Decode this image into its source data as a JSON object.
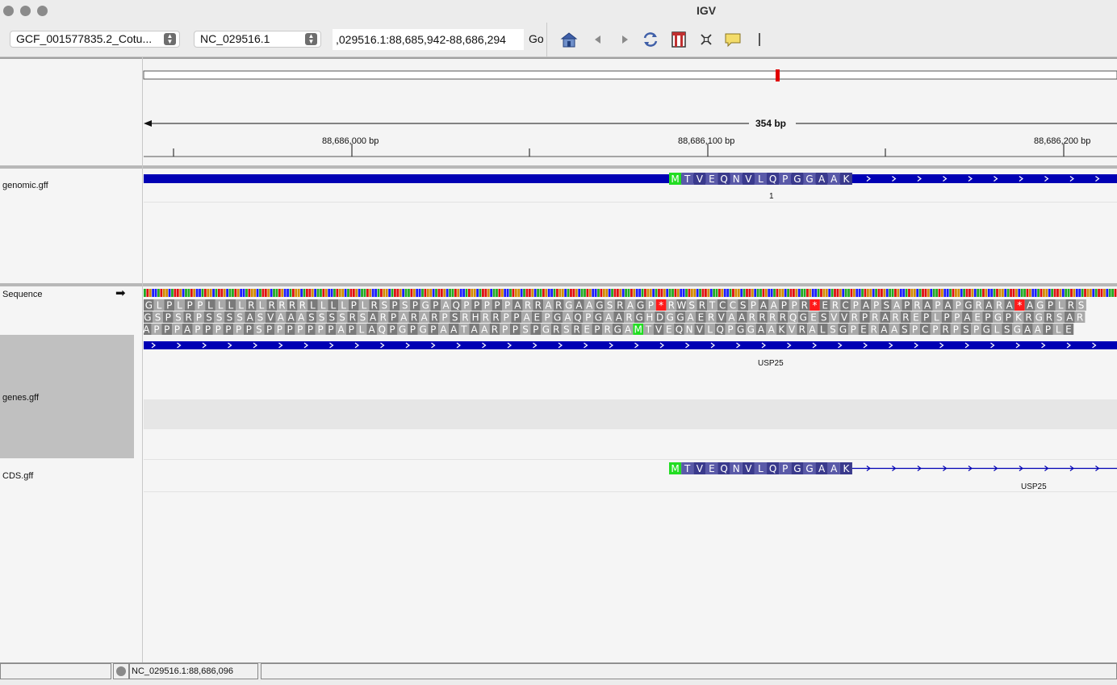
{
  "app_title": "IGV",
  "toolbar": {
    "genome": "GCF_001577835.2_Cotu...",
    "chromosome": "NC_029516.1",
    "locus": ",029516.1:88,685,942-88,686,294",
    "go_label": "Go",
    "icons": [
      "home-icon",
      "back-icon",
      "forward-icon",
      "refresh-icon",
      "roi-icon",
      "fit-window-icon",
      "popup-info-icon",
      "ruler-line-icon"
    ]
  },
  "ruler": {
    "span_label": "354 bp",
    "ticks": [
      "88,686,000 bp",
      "88,686,100 bp",
      "88,686,200 bp"
    ]
  },
  "tracks": {
    "genomic": {
      "name": "genomic.gff",
      "aa": "MTVEQNVLQPGGAAK",
      "feature_label": "1"
    },
    "sequence": {
      "name": "Sequence",
      "strand_arrow": "➡",
      "frames": [
        "GLPLPPLLLLRLRRRRLLLLPLRSPSPGPAQPPPPPARRARGAAGSRAGP*RWSRTCCSPAAPPR*ERCPAPSAPRAPAPGRARA*AGPLRS",
        "GSPSRPSSSSASVAAASSSSRSARPARARPSRHRRPPAEPGAQPGAARGHDGGAERVAARRRRQGESVVRPRARREPLPPAEPGPKRGRSAR",
        "APPPAPPPPPPSPPPPPPPAPLAQPGPGPAATAARPPSPGRSREPRGAMTVEQNVLQPGGAAKVRALSGPERAASPCPRPSPGLSGAAPLE"
      ]
    },
    "genes": {
      "name": "genes.gff",
      "feature_label": "USP25"
    },
    "cds": {
      "name": "CDS.gff",
      "aa": "MTVEQNVLQPGGAAK",
      "feature_label": "USP25"
    }
  },
  "status": {
    "position": "NC_029516.1:88,686,096"
  },
  "colors": {
    "feature_blue": "#0000b4",
    "aa_dark": "#3a3a8c",
    "aa_light": "#5a5aa8",
    "start_green": "#22dd22",
    "stop_red": "#ff1a1a",
    "aa_gray_dark": "#7a7a7a",
    "aa_gray_light": "#a9a9a9",
    "base_A": "#22aa22",
    "base_C": "#1c1cff",
    "base_G": "#d18b00",
    "base_T": "#e01010"
  }
}
